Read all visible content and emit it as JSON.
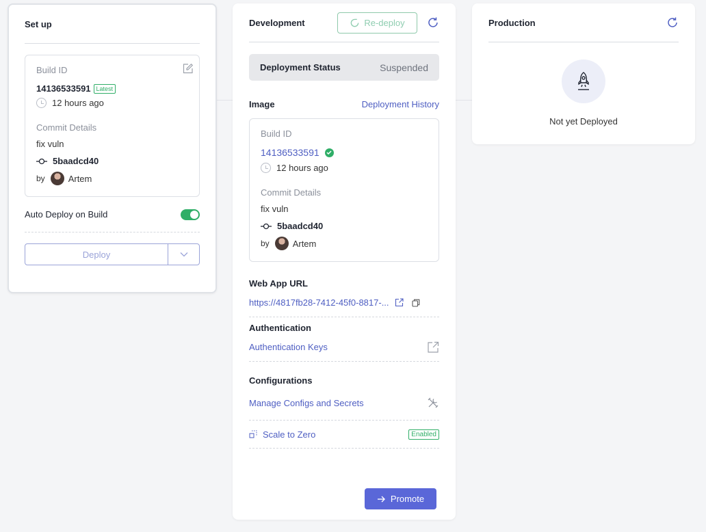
{
  "setup": {
    "title": "Set up",
    "build_id_label": "Build ID",
    "build_id": "14136533591",
    "latest_badge": "Latest",
    "time_ago": "12 hours ago",
    "commit_details_label": "Commit Details",
    "commit_message": "fix vuln",
    "commit_hash": "5baadcd40",
    "by_label": "by",
    "author": "Artem",
    "auto_deploy_label": "Auto Deploy on Build",
    "auto_deploy_enabled": true,
    "deploy_label": "Deploy"
  },
  "development": {
    "title": "Development",
    "redeploy_label": "Re-deploy",
    "deployment_status_label": "Deployment Status",
    "deployment_status_value": "Suspended",
    "image_label": "Image",
    "deployment_history_link": "Deployment History",
    "build": {
      "build_id_label": "Build ID",
      "build_id": "14136533591",
      "time_ago": "12 hours ago",
      "commit_details_label": "Commit Details",
      "commit_message": "fix vuln",
      "commit_hash": "5baadcd40",
      "by_label": "by",
      "author": "Artem"
    },
    "web_app_url_label": "Web App URL",
    "web_app_url": "https://4817fb28-7412-45f0-8817-...",
    "authentication_label": "Authentication",
    "authentication_keys_link": "Authentication Keys",
    "configurations_label": "Configurations",
    "manage_configs_link": "Manage Configs and Secrets",
    "scale_to_zero_label": "Scale to Zero",
    "scale_to_zero_badge": "Enabled",
    "promote_label": "Promote"
  },
  "production": {
    "title": "Production",
    "status_text": "Not yet Deployed"
  },
  "colors": {
    "accent": "#4e5ec2",
    "success": "#2fae67",
    "primary_button": "#5a67d8"
  }
}
